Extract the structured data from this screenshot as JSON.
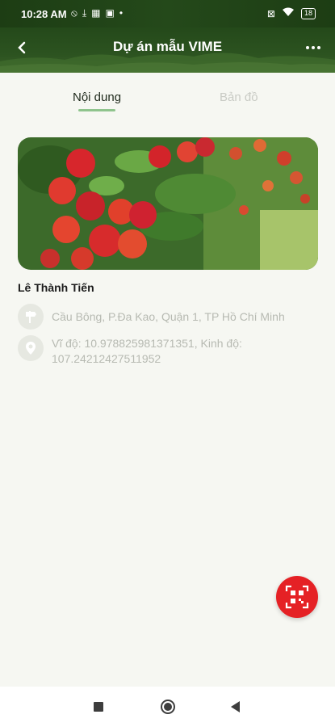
{
  "status_bar": {
    "time": "10:28 AM",
    "battery": "18",
    "icons": [
      "alarm-off-icon",
      "download-icon",
      "qr-code-icon",
      "app-notification-icon",
      "sim-icon",
      "wifi-icon",
      "battery-icon"
    ]
  },
  "header": {
    "title": "Dự án mẫu VIME"
  },
  "tabs": [
    {
      "label": "Nội dung",
      "active": true
    },
    {
      "label": "Bản đồ",
      "active": false
    }
  ],
  "project": {
    "owner": "Lê Thành Tiến",
    "address": "Cầu Bông, P.Đa Kao, Quận 1, TP Hồ Chí Minh",
    "coordinates": "Vĩ độ: 10.978825981371351, Kinh độ: 107.24212427511952"
  },
  "colors": {
    "header_green": "#24491a",
    "tab_indicator": "#8fc48d",
    "fab_red": "#e52125",
    "background": "#f6f7f2"
  }
}
